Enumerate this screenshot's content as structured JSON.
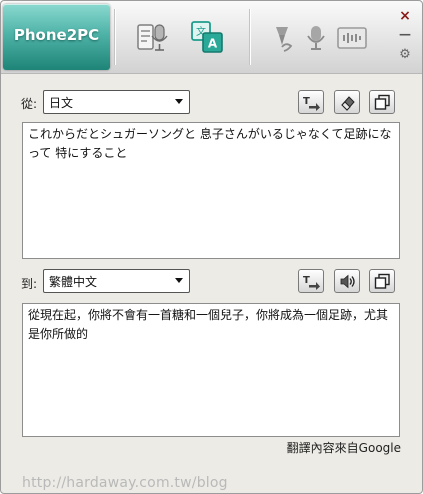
{
  "app": {
    "logo_text": "Phone2PC"
  },
  "toolbar": {
    "buttons": [
      {
        "name": "speech-input",
        "icon": "microphone-note-icon",
        "active": false
      },
      {
        "name": "translate",
        "icon": "translate-icon",
        "active": true
      },
      {
        "name": "pen",
        "icon": "pen-icon",
        "active": false
      },
      {
        "name": "mic",
        "icon": "microphone-icon",
        "active": false
      },
      {
        "name": "audio",
        "icon": "sound-wave-icon",
        "active": false
      }
    ]
  },
  "window_controls": {
    "close": "×",
    "minimize": "—",
    "settings": "⚙"
  },
  "source": {
    "label": "從:",
    "language": "日文",
    "text": "これからだとシュガーソングと 息子さんがいるじゃなくて足跡になって 特にすること"
  },
  "target": {
    "label": "到:",
    "language": "繁體中文",
    "text": "從現在起，你將不會有一首糖和一個兒子，你將成為一個足跡，尤其是你所做的"
  },
  "credit": "翻譯內容來自Google",
  "watermark": "http://hardaway.com.tw/blog",
  "colors": {
    "accent": "#3aa99b",
    "active_icon": "#1e9c8c",
    "inactive_icon": "#8c8c8c"
  }
}
